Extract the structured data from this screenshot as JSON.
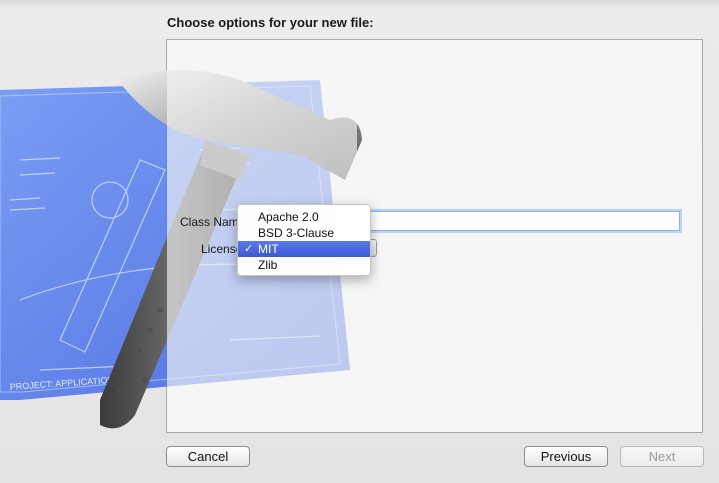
{
  "sheet": {
    "title": "Choose options for your new file:"
  },
  "form": {
    "class_name_label": "Class Name",
    "class_name_value": "",
    "license_label": "License"
  },
  "license_menu": {
    "items": [
      {
        "label": "Apache 2.0",
        "selected": false
      },
      {
        "label": "BSD 3-Clause",
        "selected": false
      },
      {
        "label": "MIT",
        "selected": true
      },
      {
        "label": "Zlib",
        "selected": false
      }
    ],
    "check_glyph": "✓"
  },
  "buttons": {
    "cancel": "Cancel",
    "previous": "Previous",
    "next": "Next"
  },
  "artwork": {
    "blueprint_text": "PROJECT: APPLICATION.APP",
    "icon": "xcode-hammer-blueprint-icon"
  },
  "colors": {
    "menu_highlight": "#3a59d6",
    "blueprint": "#5b82f0",
    "focus_ring": "#b9d3f5"
  }
}
